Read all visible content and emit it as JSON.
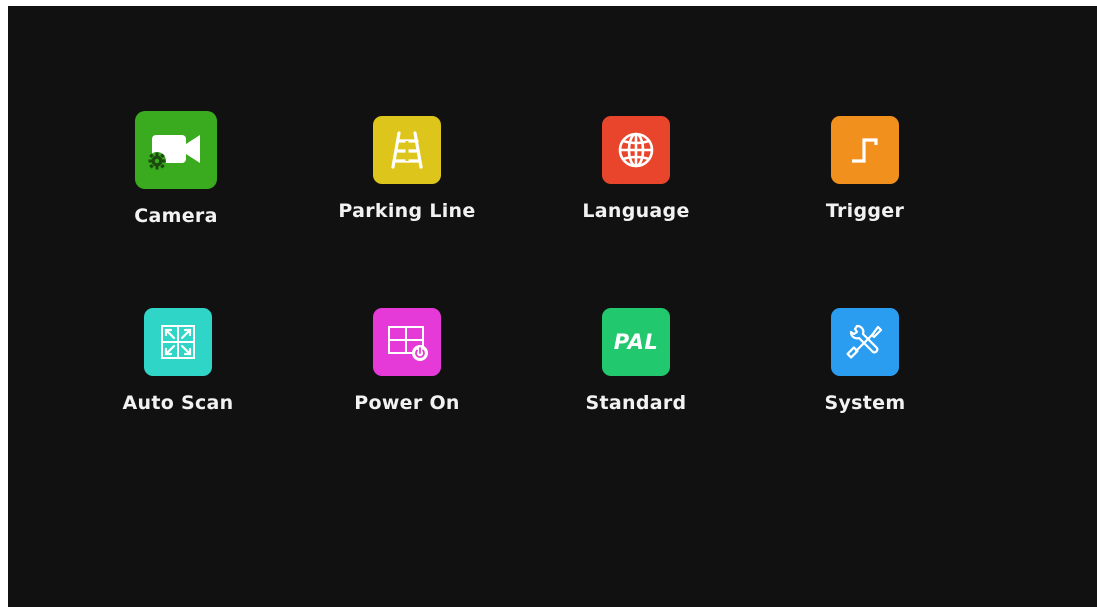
{
  "menu": {
    "items": [
      {
        "id": "camera",
        "label": "Camera",
        "icon": "video-camera-settings-icon",
        "color": "#3aaa1f"
      },
      {
        "id": "parking-line",
        "label": "Parking Line",
        "icon": "parking-lines-icon",
        "color": "#ddc51b"
      },
      {
        "id": "language",
        "label": "Language",
        "icon": "globe-icon",
        "color": "#e8452c"
      },
      {
        "id": "trigger",
        "label": "Trigger",
        "icon": "trigger-step-icon",
        "color": "#f2901d"
      },
      {
        "id": "auto-scan",
        "label": "Auto Scan",
        "icon": "quad-arrows-icon",
        "color": "#2fd5c6"
      },
      {
        "id": "power-on",
        "label": "Power On",
        "icon": "grid-power-icon",
        "color": "#e53ad8"
      },
      {
        "id": "standard",
        "label": "Standard",
        "icon_text": "PAL",
        "color": "#22c86e"
      },
      {
        "id": "system",
        "label": "System",
        "icon": "tools-icon",
        "color": "#2b9df0"
      }
    ]
  }
}
